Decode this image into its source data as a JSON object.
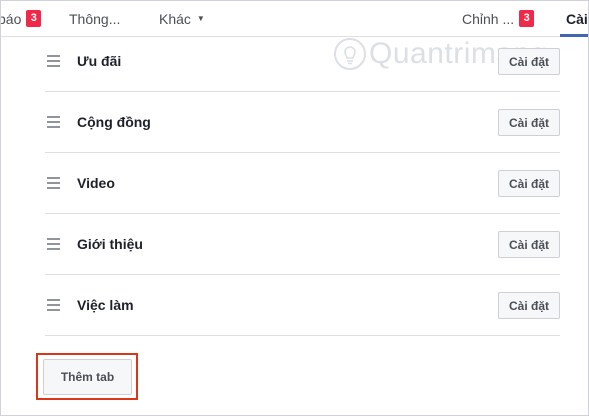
{
  "nav": {
    "items": [
      {
        "label": "báo",
        "badge": "3"
      },
      {
        "label": "Thông...",
        "badge": ""
      },
      {
        "label": "Khác",
        "badge": ""
      },
      {
        "label": "Chỉnh ...",
        "badge": "3"
      },
      {
        "label": "Cài",
        "badge": ""
      }
    ]
  },
  "tabs": [
    {
      "name": "Ưu đãi",
      "button": "Cài đặt"
    },
    {
      "name": "Cộng đồng",
      "button": "Cài đặt"
    },
    {
      "name": "Video",
      "button": "Cài đặt"
    },
    {
      "name": "Giới thiệu",
      "button": "Cài đặt"
    },
    {
      "name": "Việc làm",
      "button": "Cài đặt"
    }
  ],
  "add_tab_label": "Thêm tab",
  "watermark": "Quantrimang",
  "colors": {
    "accent": "#4267b2",
    "badge": "#f02849",
    "highlight": "#d9361a"
  }
}
